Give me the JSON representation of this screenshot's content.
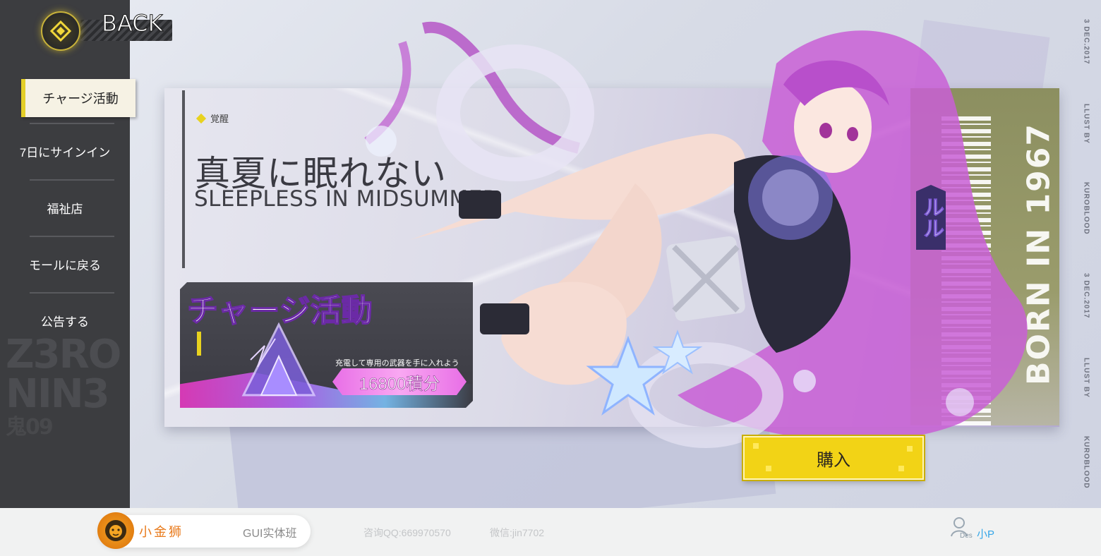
{
  "nav": {
    "back_label": "BACK",
    "items": [
      {
        "label": "チャージ活動",
        "active": true
      },
      {
        "label": "7日にサインイン",
        "active": false
      },
      {
        "label": "福祉店",
        "active": false
      },
      {
        "label": "モールに戻る",
        "active": false
      },
      {
        "label": "公告する",
        "active": false
      }
    ],
    "watermark": {
      "line1": "Z3RO",
      "line2": "NIN3",
      "line3": "鬼09"
    }
  },
  "banner": {
    "tag": "覚醒",
    "title_jp": "真夏に眠れない",
    "title_en": "SLEEPLESS IN MIDSUMMER",
    "charge": {
      "title": "チャージ活動",
      "note": "充電して専用の武器を手に入れよう",
      "points": "16800積分"
    },
    "character_name": "ルル",
    "born": "BORN IN 1967"
  },
  "credits": [
    "3 DEC.2017",
    "LLUST BY",
    "KUROBLOOD",
    "3 DEC.2017",
    "LLUST BY",
    "KUROBLOOD"
  ],
  "buy_label": "購入",
  "footer": {
    "brand": "小金狮",
    "course": "GUI实体班",
    "qq": "咨询QQ:669970570",
    "wechat": "微信:jin7702",
    "user_tag": "Des",
    "user_name": "小P"
  },
  "colors": {
    "accent_yellow": "#f2d316",
    "sidebar": "#3c3d40",
    "brand_orange": "#e8791a",
    "user_blue": "#35a6e8",
    "points_pink": "#e86ee6"
  }
}
